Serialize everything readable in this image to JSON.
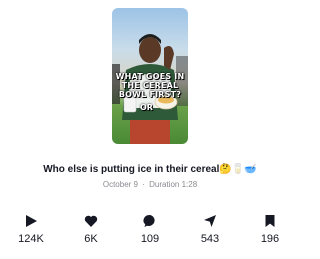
{
  "video": {
    "overlay_text": "WHAT GOES IN THE CEREAL BOWL FIRST?",
    "overlay_or": "OR"
  },
  "caption": "Who else is putting ice in their cereal🤔🥛🥣",
  "meta": {
    "date": "October 9",
    "separator": "·",
    "duration": "Duration 1:28"
  },
  "stats": {
    "plays": "124K",
    "likes": "6K",
    "comments": "109",
    "shares": "543",
    "saves": "196"
  },
  "icons": {
    "plays": "play-icon",
    "likes": "heart-icon",
    "comments": "comment-bubble-icon",
    "shares": "share-arrow-icon",
    "saves": "bookmark-icon"
  }
}
